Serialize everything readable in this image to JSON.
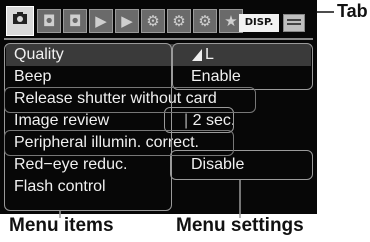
{
  "tabs": [
    {
      "icon": "camera-icon",
      "active": true
    },
    {
      "icon": "camera-settings-2-icon",
      "active": false
    },
    {
      "icon": "camera-settings-3-icon",
      "active": false
    },
    {
      "icon": "playback-1-icon",
      "active": false
    },
    {
      "icon": "playback-2-icon",
      "active": false
    },
    {
      "icon": "setup-1-icon",
      "active": false
    },
    {
      "icon": "setup-2-icon",
      "active": false
    },
    {
      "icon": "setup-3-icon",
      "active": false
    },
    {
      "icon": "my-menu-star-icon",
      "active": false
    }
  ],
  "disp_label": "DISP.",
  "menu": {
    "items": [
      {
        "label": "Quality",
        "value": "L",
        "value_icon": "quality-L-icon"
      },
      {
        "label": "Beep",
        "value": "Enable"
      },
      {
        "label": "Release shutter without card",
        "value": ""
      },
      {
        "label": "Image review",
        "value": "2 sec."
      },
      {
        "label": "Peripheral illumin. correct.",
        "value": ""
      },
      {
        "label": "Red−eye reduc.",
        "value": "Disable"
      },
      {
        "label": "Flash control",
        "value": ""
      }
    ]
  },
  "callouts": {
    "tab": "Tab",
    "menu_items": "Menu items",
    "menu_settings": "Menu settings"
  },
  "colors": {
    "screen_bg": "#070707",
    "bracket": "#9a9a9a",
    "text": "#f0f0f0"
  }
}
